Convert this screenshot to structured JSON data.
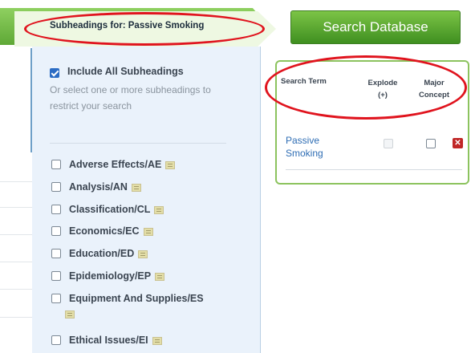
{
  "subheadings_panel": {
    "title": "Subheadings for: Passive Smoking",
    "include_all_label": "Include All Subheadings",
    "include_all_checked": true,
    "help_text": "Or select one or more subheadings to restrict your search",
    "items": [
      {
        "label": "Adverse Effects/AE",
        "checked": false
      },
      {
        "label": "Analysis/AN",
        "checked": false
      },
      {
        "label": "Classification/CL",
        "checked": false
      },
      {
        "label": "Economics/EC",
        "checked": false
      },
      {
        "label": "Education/ED",
        "checked": false
      },
      {
        "label": "Epidemiology/EP",
        "checked": false
      },
      {
        "label": "Equipment And Supplies/ES",
        "checked": false
      },
      {
        "label": "Ethical Issues/EI",
        "checked": false
      }
    ]
  },
  "search_button": {
    "label": "Search Database"
  },
  "search_terms": {
    "headers": {
      "term": "Search Term",
      "explode": "Explode (+)",
      "major": "Major Concept"
    },
    "rows": [
      {
        "term": "Passive Smoking",
        "explode_checked": false,
        "explode_disabled": true,
        "major_checked": false
      }
    ]
  },
  "colors": {
    "accent_green": "#5ea836",
    "annotation_red": "#e0141e",
    "panel_bg": "#eaf2fb",
    "link_blue": "#2e6db4"
  }
}
